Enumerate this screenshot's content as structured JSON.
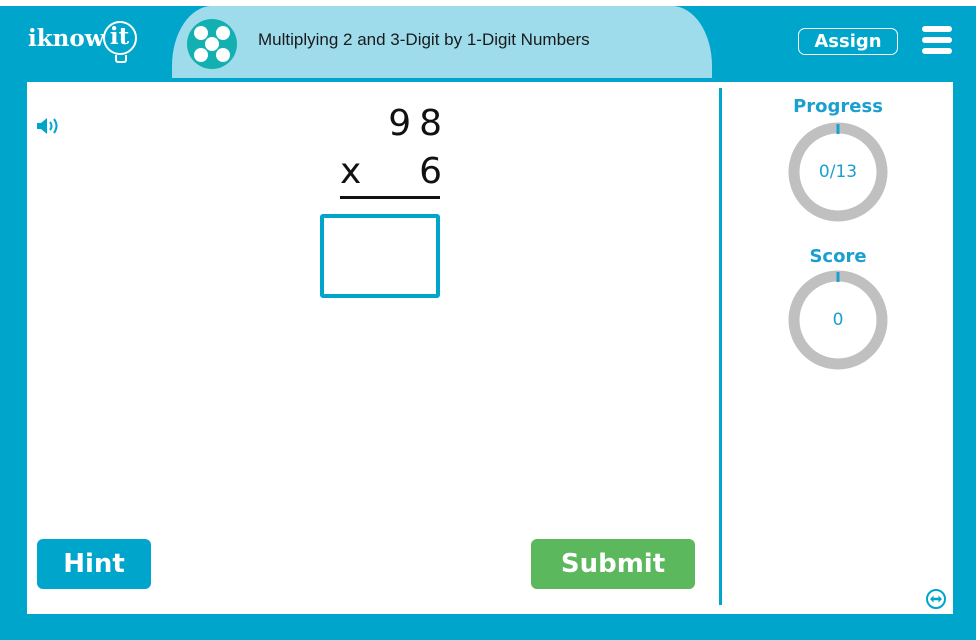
{
  "header": {
    "logo_text": "iknow",
    "logo_bulb_text": "it",
    "topic_icon": "five-dots-dice-icon",
    "title": "Multiplying 2 and 3-Digit by 1-Digit Numbers",
    "assign_label": "Assign",
    "menu_icon": "hamburger-menu-icon"
  },
  "problem": {
    "sound_icon": "speaker-icon",
    "top_number": "98",
    "operator": "x",
    "bottom_number": "6",
    "answer_value": ""
  },
  "stats": {
    "progress_label": "Progress",
    "progress_value": "0/13",
    "progress_fraction": 0,
    "score_label": "Score",
    "score_value": "0",
    "score_fraction": 0
  },
  "actions": {
    "hint_label": "Hint",
    "submit_label": "Submit",
    "expand_icon": "expand-horizontal-icon"
  },
  "colors": {
    "brand_blue": "#00a5cc",
    "title_band": "#9edcec",
    "topic_icon_bg": "#12b0b0",
    "submit_green": "#5cb85c",
    "stat_text": "#1b9fcf",
    "ring_gray": "#c0c0c0"
  }
}
